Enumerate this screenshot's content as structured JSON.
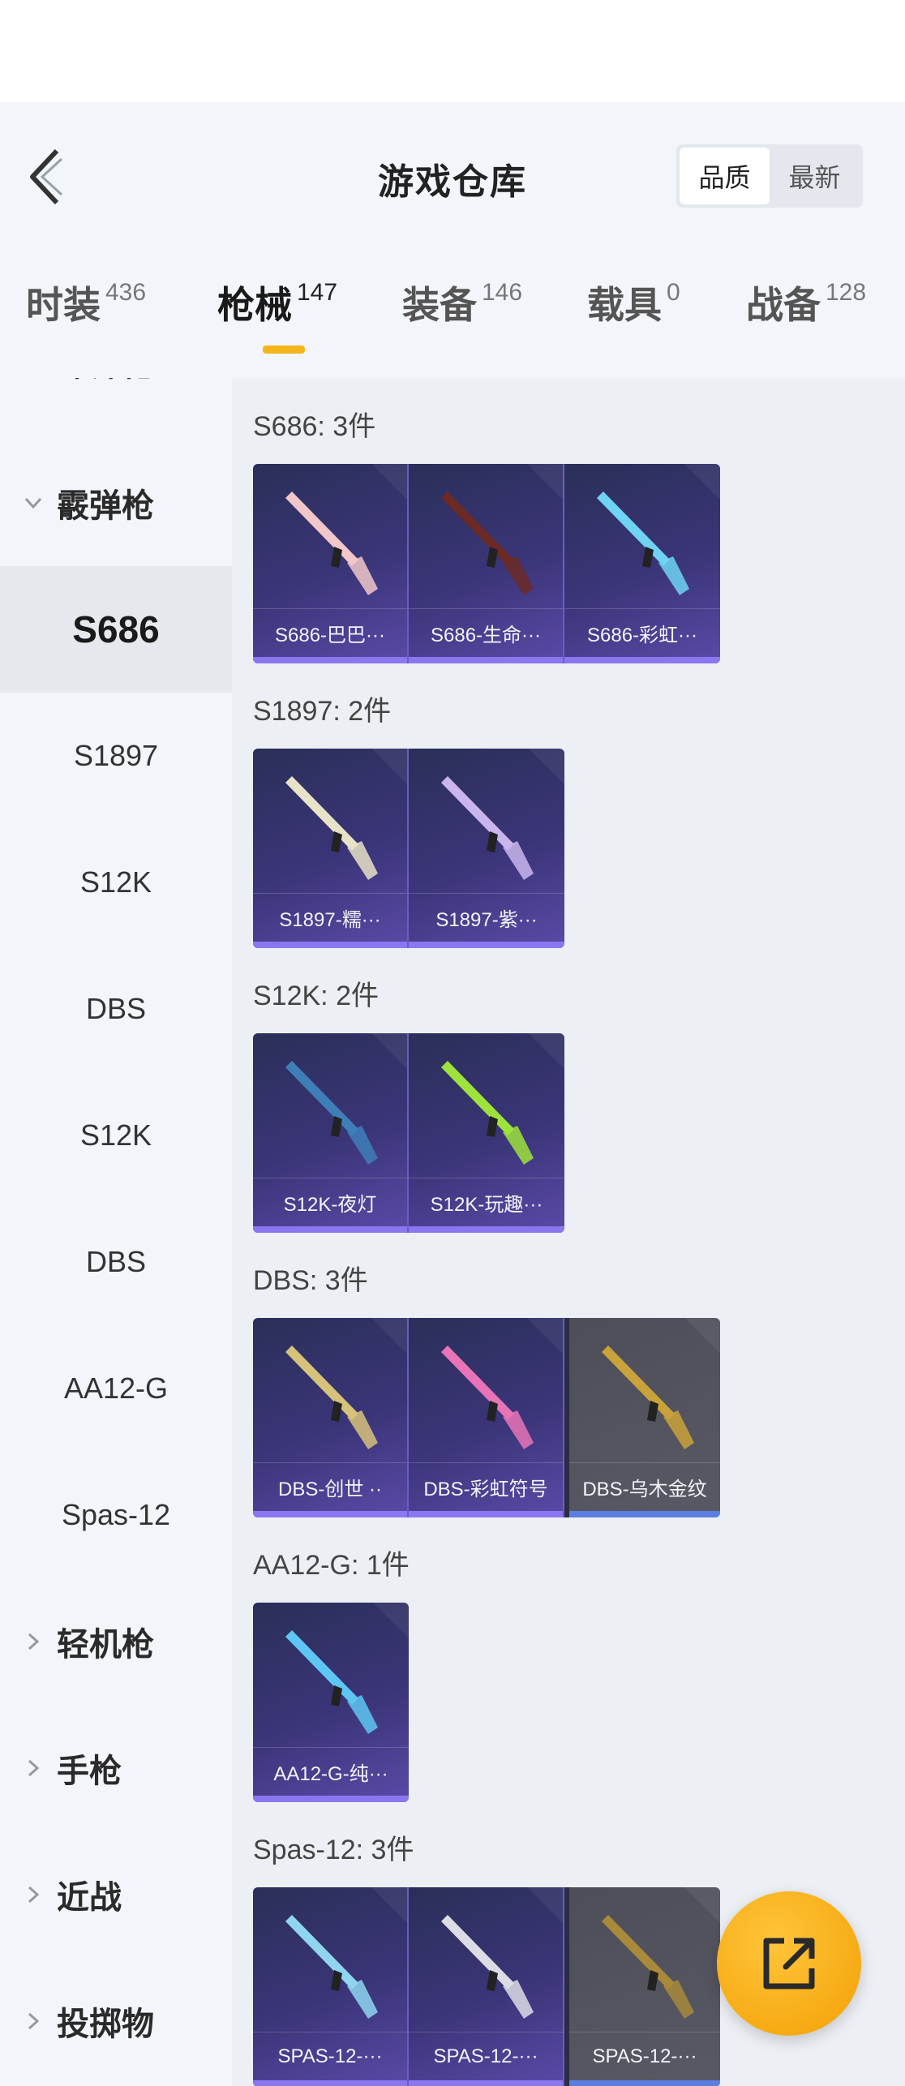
{
  "header": {
    "title": "游戏仓库",
    "sort": {
      "quality": "品质",
      "newest": "最新",
      "selected": "quality"
    }
  },
  "tabs": [
    {
      "label": "时装",
      "count": "436"
    },
    {
      "label": "枪械",
      "count": "147",
      "active": true
    },
    {
      "label": "装备",
      "count": "146"
    },
    {
      "label": "载具",
      "count": "0"
    },
    {
      "label": "战备",
      "count": "128"
    }
  ],
  "sidebar": {
    "partial_category": "冲锋枪",
    "open_category": "霰弹枪",
    "items": [
      "S686",
      "S1897",
      "S12K",
      "DBS",
      "S12K",
      "DBS",
      "AA12-G",
      "Spas-12"
    ],
    "active_item": "S686",
    "collapsed_categories": [
      "轻机枪",
      "手枪",
      "近战",
      "投掷物"
    ]
  },
  "groups": [
    {
      "title": "S686: 3件",
      "items": [
        {
          "name": "S686-巴巴···",
          "color": "#f1c7c9"
        },
        {
          "name": "S686-生命···",
          "color": "#6b2a26"
        },
        {
          "name": "S686-彩虹···",
          "color": "#6fd3f4"
        }
      ]
    },
    {
      "title": "S1897: 2件",
      "items": [
        {
          "name": "S1897-糯···",
          "color": "#e8e3c6"
        },
        {
          "name": "S1897-紫···",
          "color": "#c9b6ee"
        }
      ]
    },
    {
      "title": "S12K: 2件",
      "items": [
        {
          "name": "S12K-夜灯",
          "color": "#3e7fb8"
        },
        {
          "name": "S12K-玩趣···",
          "color": "#9ee23c"
        }
      ]
    },
    {
      "title": "DBS: 3件",
      "items": [
        {
          "name": "DBS-创世 ··",
          "color": "#d7c27a"
        },
        {
          "name": "DBS-彩虹符号",
          "color": "#e874b7"
        },
        {
          "name": "DBS-乌木金纹",
          "color": "#c9a23a",
          "gray": true
        }
      ]
    },
    {
      "title": "AA12-G: 1件",
      "items": [
        {
          "name": "AA12-G-纯···",
          "color": "#5ec6f2"
        }
      ]
    },
    {
      "title": "Spas-12: 3件",
      "items": [
        {
          "name": "SPAS-12-···",
          "color": "#8fd5f0"
        },
        {
          "name": "SPAS-12-···",
          "color": "#dcdce6"
        },
        {
          "name": "SPAS-12-···",
          "color": "#a88a3a",
          "gray": true
        }
      ]
    }
  ],
  "colors": {
    "accent": "#f5b51a",
    "card_bar": "#8a77f0",
    "fab": "#f5a70f"
  }
}
